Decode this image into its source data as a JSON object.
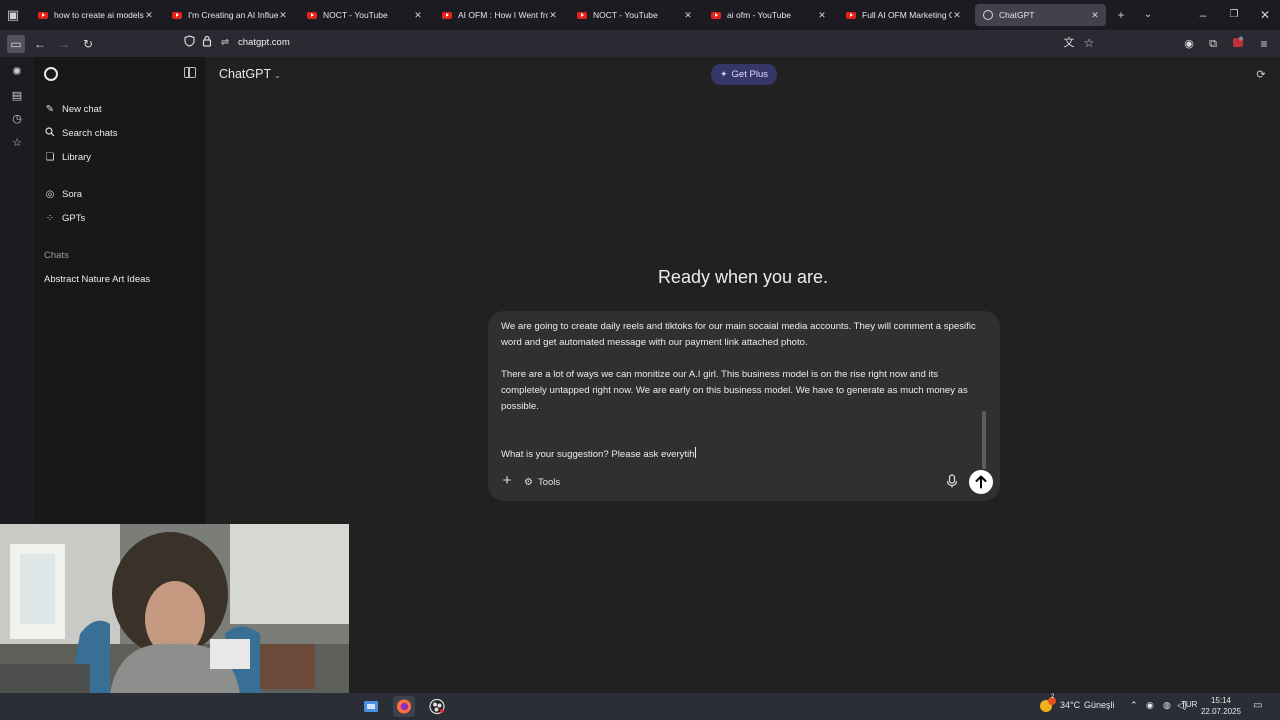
{
  "tabs": [
    {
      "title": "how to create ai models fo",
      "icon": "youtube-icon"
    },
    {
      "title": "I'm Creating an AI Influenc",
      "icon": "youtube-icon"
    },
    {
      "title": "NOCT - YouTube",
      "icon": "youtube-icon"
    },
    {
      "title": "AI OFM : How I Went from",
      "icon": "youtube-icon"
    },
    {
      "title": "NOCT - YouTube",
      "icon": "youtube-icon"
    },
    {
      "title": "ai ofm - YouTube",
      "icon": "youtube-icon"
    },
    {
      "title": "Full AI OFM Marketing Gui",
      "icon": "youtube-icon"
    },
    {
      "title": "ChatGPT",
      "icon": "chatgpt-icon",
      "active": true
    }
  ],
  "address_bar": {
    "url": "chatgpt.com"
  },
  "sidebar": {
    "nav": [
      {
        "label": "New chat",
        "icon": "compose-icon"
      },
      {
        "label": "Search chats",
        "icon": "search-icon"
      },
      {
        "label": "Library",
        "icon": "library-icon"
      },
      {
        "label": "Sora",
        "icon": "sora-icon"
      },
      {
        "label": "GPTs",
        "icon": "gpts-icon"
      }
    ],
    "chats_heading": "Chats",
    "chats": [
      "Abstract Nature Art Ideas"
    ]
  },
  "header": {
    "model": "ChatGPT",
    "get_plus": "Get Plus"
  },
  "main": {
    "headline": "Ready when you are."
  },
  "composer": {
    "paragraph_1": "We are going to create daily reels and tiktoks for our main socaial media accounts. They will comment a spesific word and get automated message with our payment link attached photo.",
    "paragraph_2": "There are a lot of ways we can monitize our A.I girl. This business model is on the rise right now and its completely untapped right now. We are early on this business model. We have to generate as much money as possible.",
    "paragraph_3": "What is your suggestion? Please ask everytih",
    "tools_label": "Tools"
  },
  "taskbar": {
    "weather_temp": "34°C",
    "weather_desc": "Güneşli",
    "language": "TUR",
    "time": "15:14",
    "date": "22.07.2025",
    "weather_badge": "2"
  },
  "colors": {
    "youtube_red": "#e62117",
    "get_plus_bg": "#373669",
    "main_bg": "#212121",
    "sidebar_bg": "#181818",
    "composer_bg": "#303030"
  }
}
